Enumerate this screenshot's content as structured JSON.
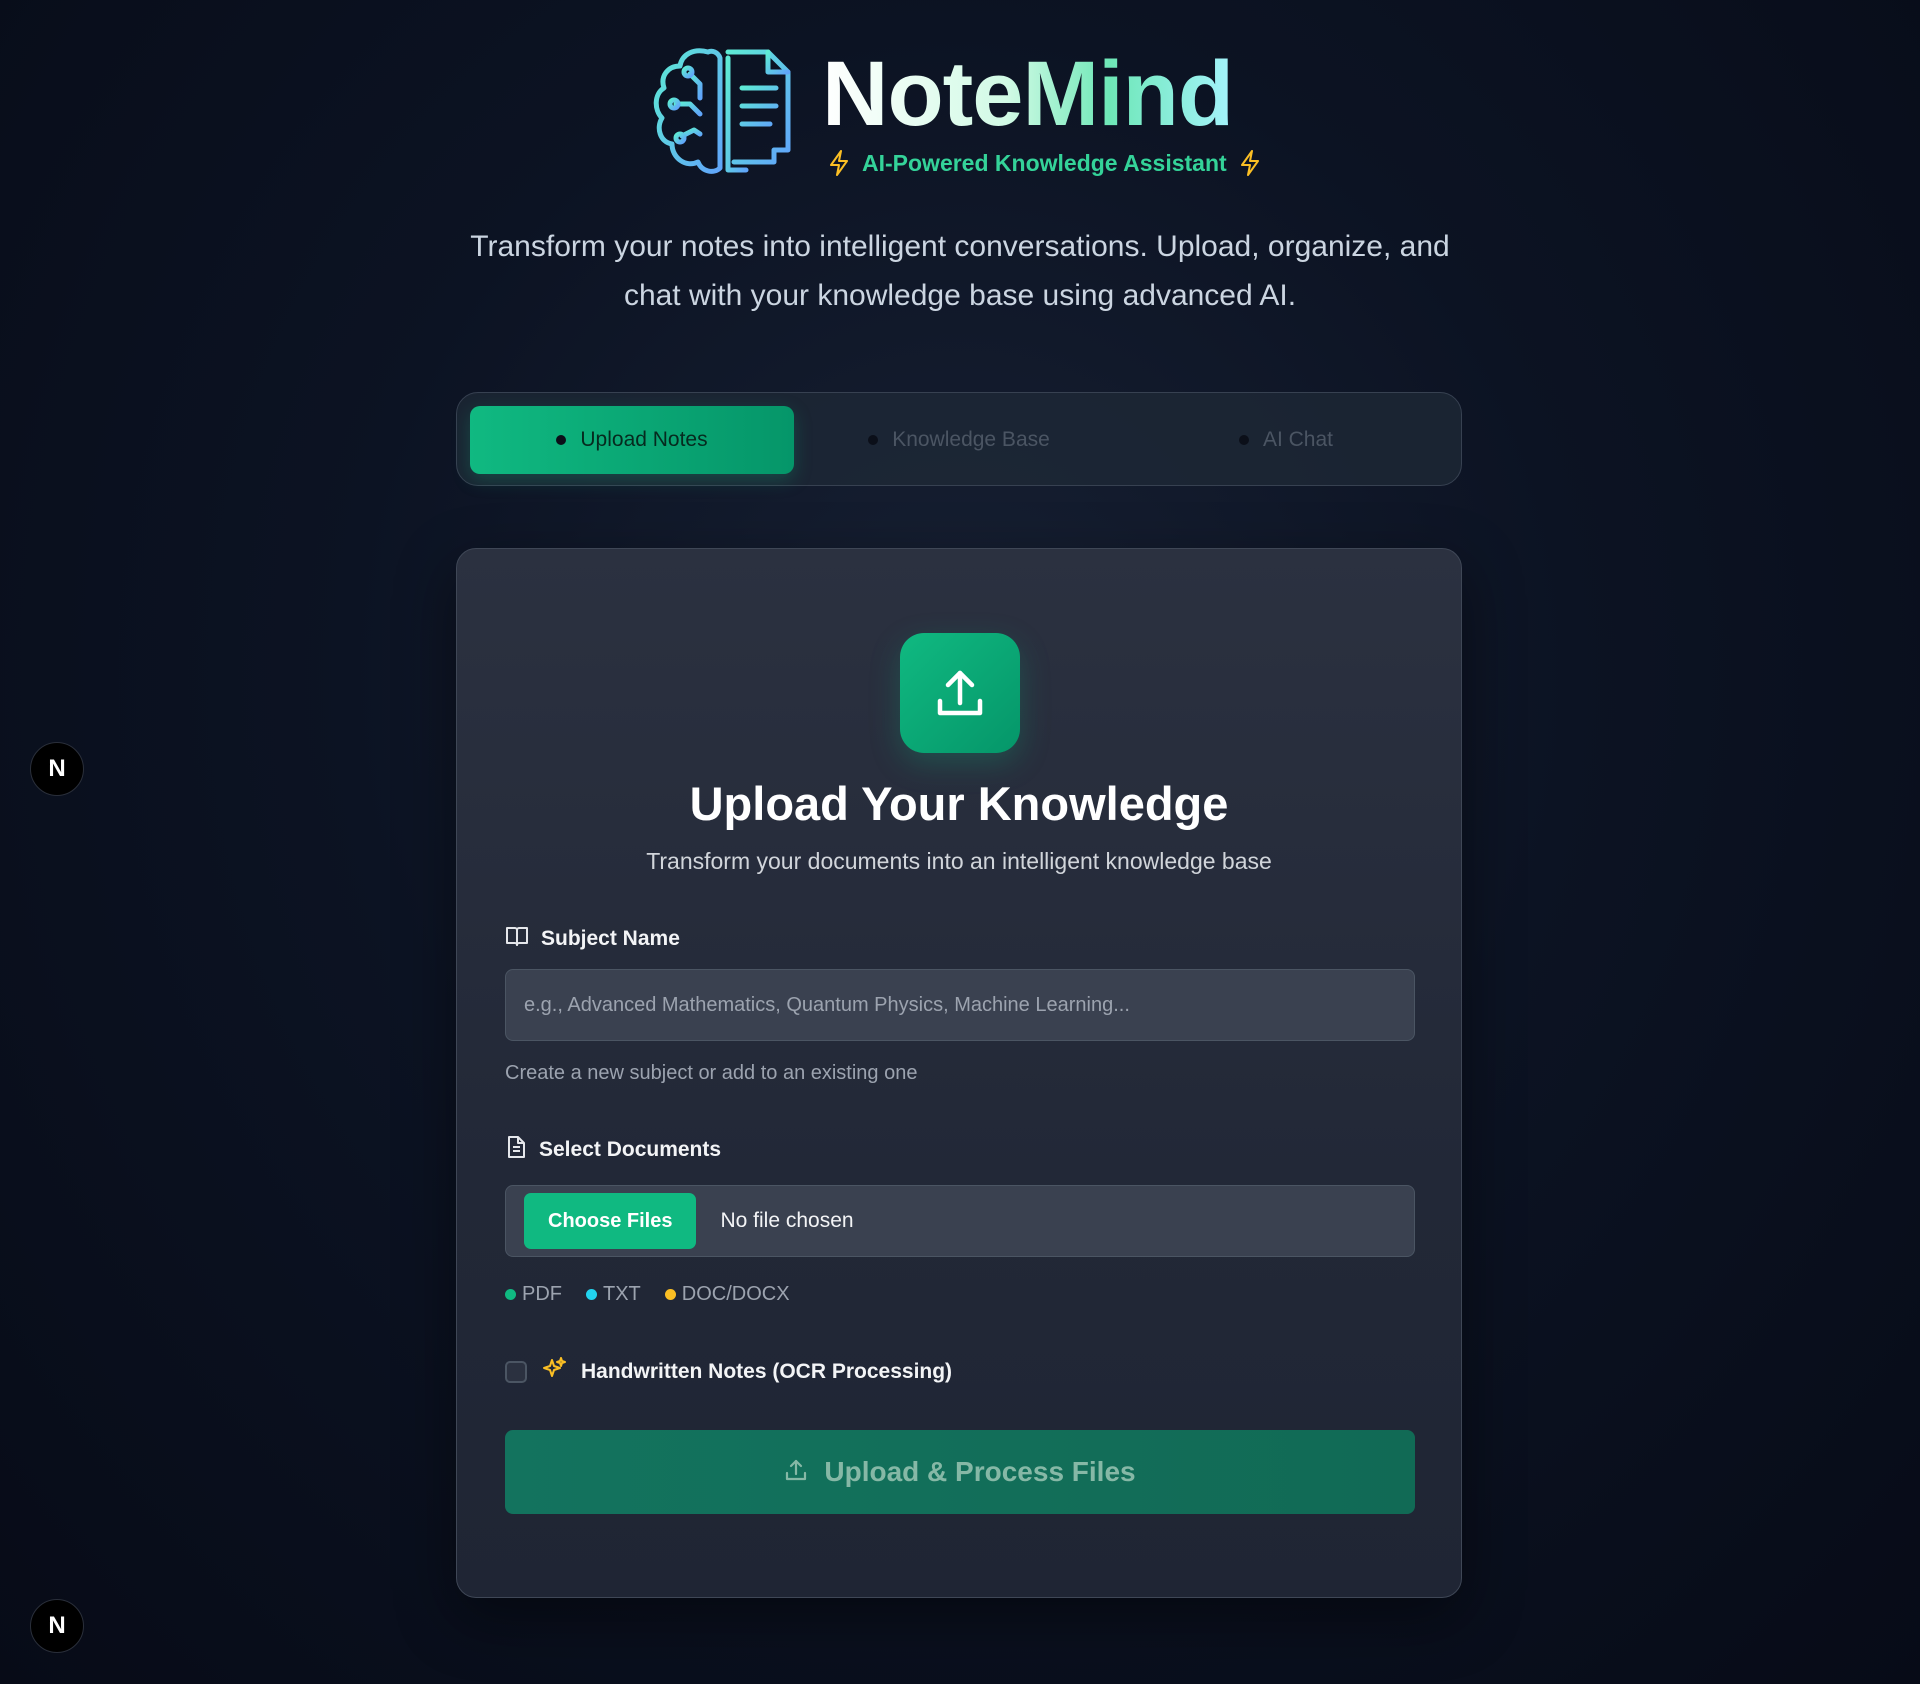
{
  "header": {
    "brand": "NoteMind",
    "tagline": "AI-Powered Knowledge Assistant",
    "intro": "Transform your notes into intelligent conversations. Upload, organize, and chat with your knowledge base using advanced AI."
  },
  "tabs": [
    {
      "label": "Upload Notes",
      "active": true
    },
    {
      "label": "Knowledge Base",
      "active": false
    },
    {
      "label": "AI Chat",
      "active": false
    }
  ],
  "upload_card": {
    "title": "Upload Your Knowledge",
    "subtitle": "Transform your documents into an intelligent knowledge base",
    "subject": {
      "label": "Subject Name",
      "placeholder": "e.g., Advanced Mathematics, Quantum Physics, Machine Learning...",
      "value": "",
      "hint": "Create a new subject or add to an existing one"
    },
    "documents": {
      "label": "Select Documents",
      "choose_button": "Choose Files",
      "status": "No file chosen",
      "formats": [
        {
          "label": "PDF",
          "color": "#10b981"
        },
        {
          "label": "TXT",
          "color": "#22d3ee"
        },
        {
          "label": "DOC/DOCX",
          "color": "#fbbf24"
        }
      ]
    },
    "ocr": {
      "label": "Handwritten Notes (OCR Processing)",
      "checked": false
    },
    "submit_label": "Upload & Process Files"
  },
  "floating_badges": [
    "N",
    "N"
  ],
  "colors": {
    "accent": "#10b981",
    "tagline": "#34d399",
    "spark": "#fbbf24"
  }
}
